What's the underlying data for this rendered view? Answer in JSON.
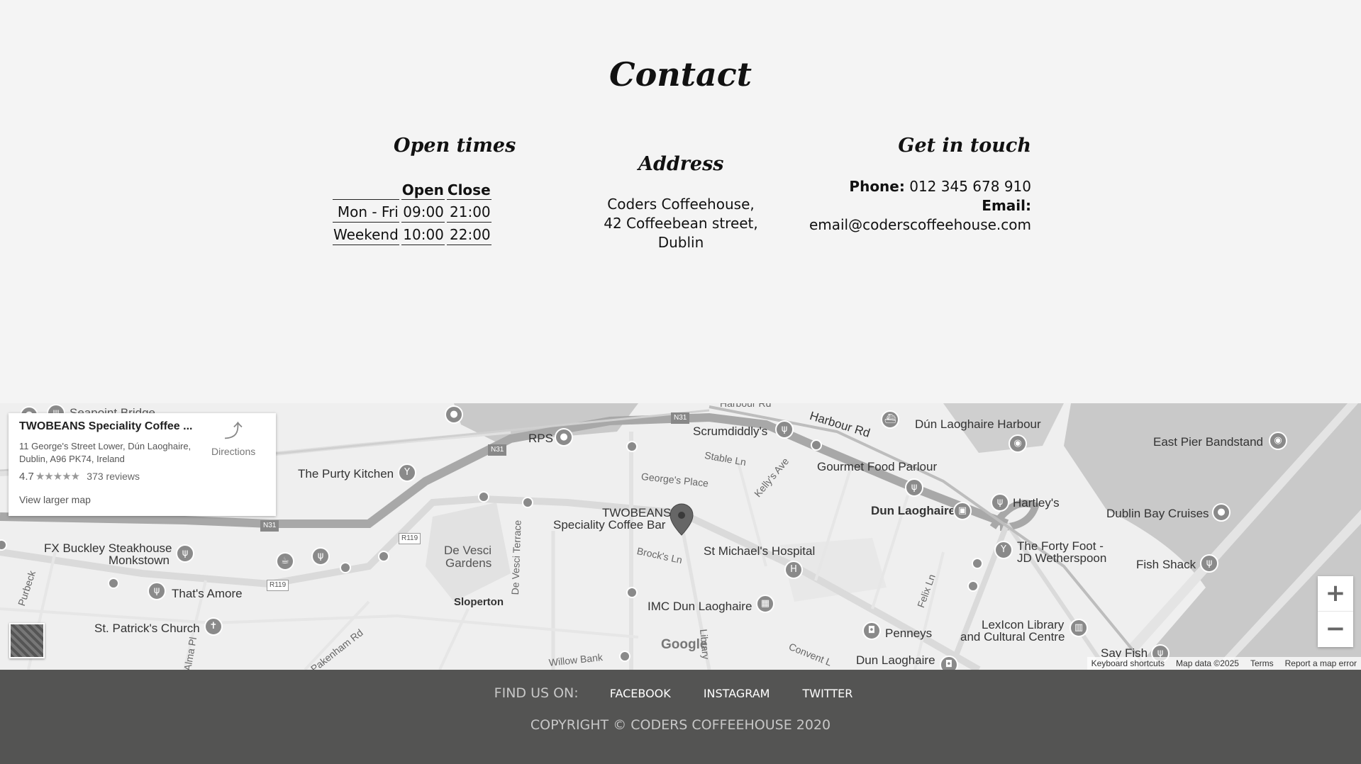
{
  "contact": {
    "title": "Contact",
    "open_times": {
      "title": "Open times",
      "headers": [
        "Open",
        "Close"
      ],
      "rows": [
        {
          "day": "Mon - Fri",
          "open": "09:00",
          "close": "21:00"
        },
        {
          "day": "Weekend",
          "open": "10:00",
          "close": "22:00"
        }
      ]
    },
    "address": {
      "title": "Address",
      "lines": [
        "Coders Coffeehouse,",
        "42 Coffeebean street,",
        "Dublin"
      ]
    },
    "get_in_touch": {
      "title": "Get in touch",
      "phone_label": "Phone:",
      "phone": "012 345 678 910",
      "email_label": "Email:",
      "email": "email@coderscoffeehouse.com"
    }
  },
  "map": {
    "card": {
      "name": "TWOBEANS Speciality Coffee ...",
      "address": "11 George's Street Lower, Dún Laoghaire, Dublin, A96 PK74, Ireland",
      "rating": "4.7",
      "stars": "★★★★★",
      "reviews": "373 reviews",
      "directions": "Directions",
      "larger_map": "View larger map"
    },
    "labels": {
      "seapoint": "Seapoint Bridge",
      "purty": "The Purty Kitchen",
      "rps": "RPS",
      "scrumdiddlys": "Scrumdiddly's",
      "harbour_rd": "Harbour Rd",
      "harbour_rd_top": "Harbour Rd",
      "dun_harbour": "Dún Laoghaire Harbour",
      "east_pier": "East Pier Bandstand",
      "stable": "Stable Ln",
      "georges": "George's Place",
      "kellys": "Kelly's Ave",
      "gourmet": "Gourmet Food Parlour",
      "hartleys": "Hartley's",
      "dun_laoghaire": "Dun Laoghaire",
      "dublin_bay": "Dublin Bay Cruises",
      "twobeans1": "TWOBEANS",
      "twobeans2": "Speciality Coffee Bar",
      "fx1": "FX Buckley Steakhouse",
      "fx2": "Monkstown",
      "devesci1": "De Vesci",
      "devesci2": "Gardens",
      "devesci_t": "De Vesci Terrace",
      "brocks": "Brock's Ln",
      "st_michaels": "St Michael's Hospital",
      "forty1": "The Forty Foot -",
      "forty2": "JD Wetherspoon",
      "fish": "Fish Shack",
      "thats_amore": "That's Amore",
      "sloperton": "Sloperton",
      "imc": "IMC Dun Laoghaire",
      "felix": "Felix Ln",
      "purbeck": "Purbeck",
      "st_patricks": "St. Patrick's Church",
      "lexicon1": "LexIcon Library",
      "lexicon2": "and Cultural Centre",
      "penneys": "Penneys",
      "pakenham": "Pakenham Rd",
      "willow": "Willow Bank",
      "library": "Library",
      "convent": "Convent L",
      "dun_laoghaire2": "Dun Laoghaire",
      "say_fish": "Say Fish",
      "alma": "Alma Pl"
    },
    "shields": {
      "n31_a": "N31",
      "n31_b": "N31",
      "n31_c": "N31",
      "r119_a": "R119",
      "r119_b": "R119"
    },
    "zoom_in": "+",
    "zoom_out": "−",
    "google": "Google",
    "attribution": {
      "shortcuts": "Keyboard shortcuts",
      "data": "Map data ©2025",
      "terms": "Terms",
      "report": "Report a map error"
    }
  },
  "footer": {
    "find_us": "FIND US ON:",
    "links": [
      "FACEBOOK",
      "INSTAGRAM",
      "TWITTER"
    ],
    "copyright": "COPYRIGHT © CODERS COFFEEHOUSE 2020"
  }
}
